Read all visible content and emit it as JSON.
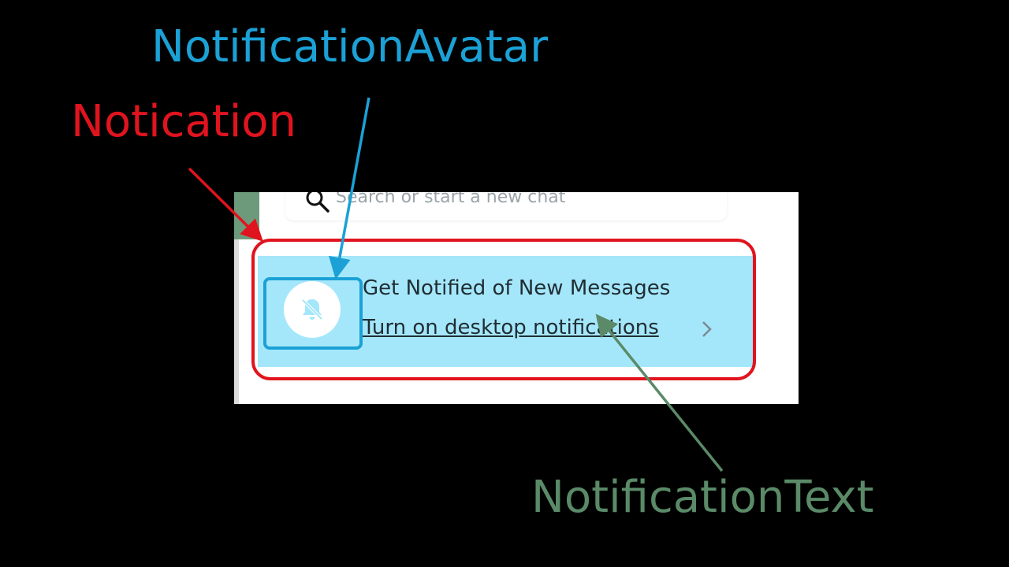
{
  "annotations": {
    "avatar_label": "NotificationAvatar",
    "notification_label": "Notication",
    "text_label": "NotificationText"
  },
  "search": {
    "placeholder": "Search or start a new chat"
  },
  "notification": {
    "title": "Get Notified of New Messages",
    "link": "Turn on desktop notifications",
    "avatar_icon": "bell-off-icon",
    "action_icon": "chevron-right-icon"
  },
  "colors": {
    "background": "#000000",
    "annotation_red": "#e0141e",
    "annotation_blue": "#1ba1d6",
    "annotation_green": "#5a8a67",
    "banner": "#a5e7fa"
  }
}
